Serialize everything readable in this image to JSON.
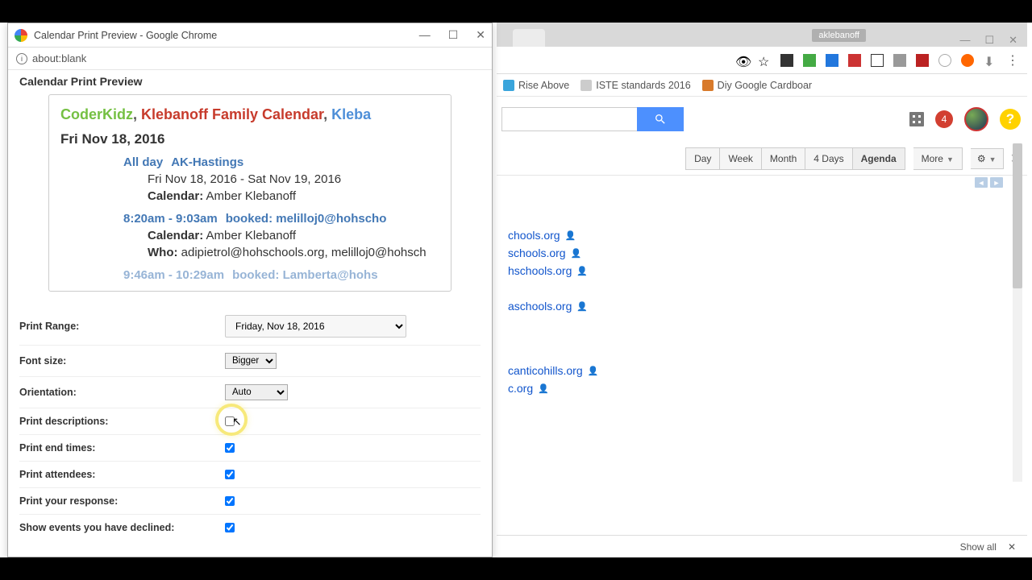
{
  "popup": {
    "window_title": "Calendar Print Preview - Google Chrome",
    "address": "about:blank",
    "heading": "Calendar Print Preview",
    "calendars": {
      "n1": "CoderKidz",
      "n2": "Klebanoff Family Calendar",
      "n3": "Kleba"
    },
    "sep": ", ",
    "date_header": "Fri Nov 18, 2016",
    "events": [
      {
        "time": "All day",
        "title": "AK-Hastings",
        "range": "Fri Nov 18, 2016 - Sat Nov 19, 2016",
        "cal_label": "Calendar:",
        "cal_value": "Amber Klebanoff"
      },
      {
        "time": "8:20am - 9:03am",
        "title": "booked:  melilloj0@hohscho",
        "cal_label": "Calendar:",
        "cal_value": "Amber Klebanoff",
        "who_label": "Who:",
        "who_value": "adipietrol@hohschools.org, melilloj0@hohsch"
      },
      {
        "time": "9:46am - 10:29am",
        "title": "booked:  Lamberta@hohs"
      }
    ],
    "options": {
      "print_range": {
        "label": "Print Range:",
        "value": "Friday, Nov 18, 2016"
      },
      "font_size": {
        "label": "Font size:",
        "value": "Bigger"
      },
      "orientation": {
        "label": "Orientation:",
        "value": "Auto"
      },
      "descriptions": {
        "label": "Print descriptions:",
        "checked": false
      },
      "end_times": {
        "label": "Print end times:",
        "checked": true
      },
      "attendees": {
        "label": "Print attendees:",
        "checked": true
      },
      "response": {
        "label": "Print your response:",
        "checked": true
      },
      "declined": {
        "label": "Show events you have declined:",
        "checked": true
      }
    }
  },
  "background": {
    "user_badge": "aklebanoff",
    "bookmarks": [
      {
        "label": "Rise Above"
      },
      {
        "label": "ISTE standards 2016"
      },
      {
        "label": "Diy Google Cardboar"
      }
    ],
    "views": {
      "day": "Day",
      "week": "Week",
      "month": "Month",
      "days4": "4 Days",
      "agenda": "Agenda",
      "more": "More"
    },
    "notif_count": "4",
    "agenda_visible": [
      "chools.org",
      "schools.org",
      "hschools.org",
      "aschools.org",
      "canticohills.org",
      "c.org"
    ],
    "footer": {
      "show_all": "Show all"
    }
  }
}
